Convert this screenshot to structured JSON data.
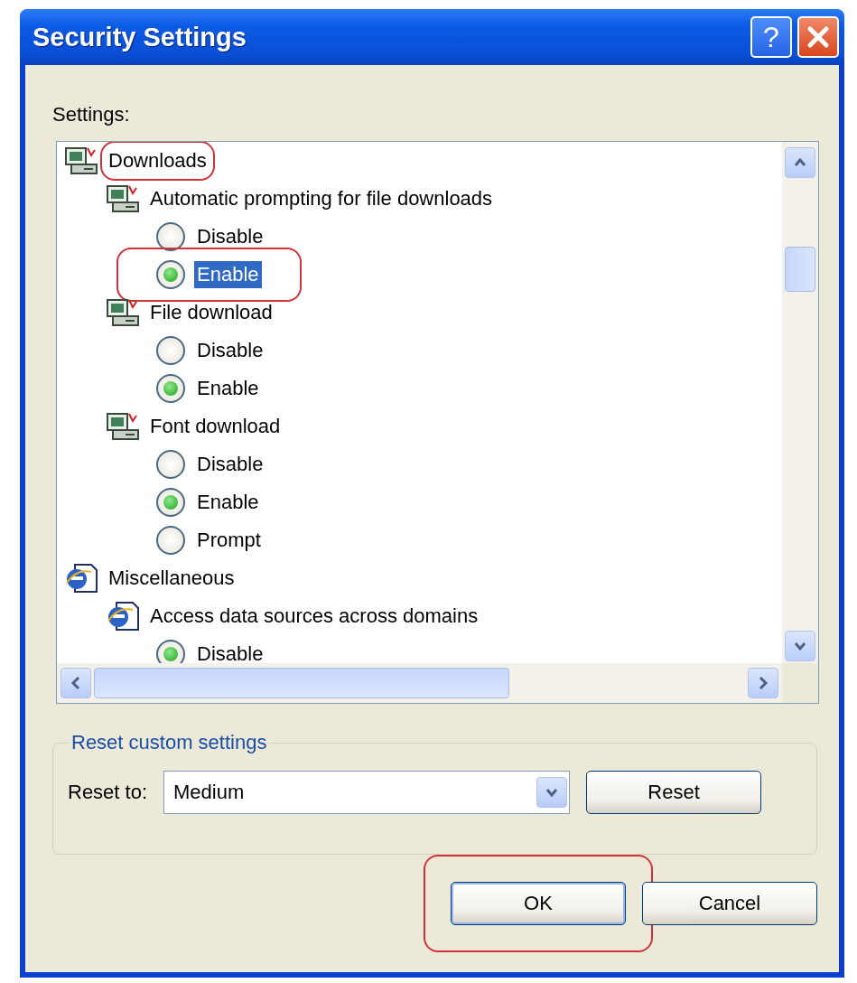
{
  "window": {
    "title": "Security Settings",
    "help": "?"
  },
  "settings_label": "Settings:",
  "tree": [
    {
      "kind": "download",
      "label": "Downloads",
      "highlighted": true,
      "children": [
        {
          "kind": "download",
          "label": "Automatic prompting for file downloads",
          "options": [
            {
              "label": "Disable",
              "selected": false,
              "focused": false,
              "highlighted": false
            },
            {
              "label": "Enable",
              "selected": true,
              "focused": true,
              "highlighted": true
            }
          ]
        },
        {
          "kind": "download",
          "label": "File download",
          "options": [
            {
              "label": "Disable",
              "selected": false,
              "focused": false,
              "highlighted": false
            },
            {
              "label": "Enable",
              "selected": true,
              "focused": false,
              "highlighted": false
            }
          ]
        },
        {
          "kind": "download",
          "label": "Font download",
          "options": [
            {
              "label": "Disable",
              "selected": false,
              "focused": false,
              "highlighted": false
            },
            {
              "label": "Enable",
              "selected": true,
              "focused": false,
              "highlighted": false
            },
            {
              "label": "Prompt",
              "selected": false,
              "focused": false,
              "highlighted": false
            }
          ]
        }
      ]
    },
    {
      "kind": "browser",
      "label": "Miscellaneous",
      "highlighted": false,
      "children": [
        {
          "kind": "browser",
          "label": "Access data sources across domains",
          "options": [
            {
              "label": "Disable",
              "selected": true,
              "focused": false,
              "highlighted": false
            }
          ]
        }
      ]
    }
  ],
  "reset_group": {
    "title": "Reset custom settings",
    "label": "Reset to:",
    "value": "Medium",
    "button": "Reset"
  },
  "buttons": [
    {
      "label": "OK",
      "highlighted": true
    },
    {
      "label": "Cancel",
      "highlighted": false
    }
  ]
}
